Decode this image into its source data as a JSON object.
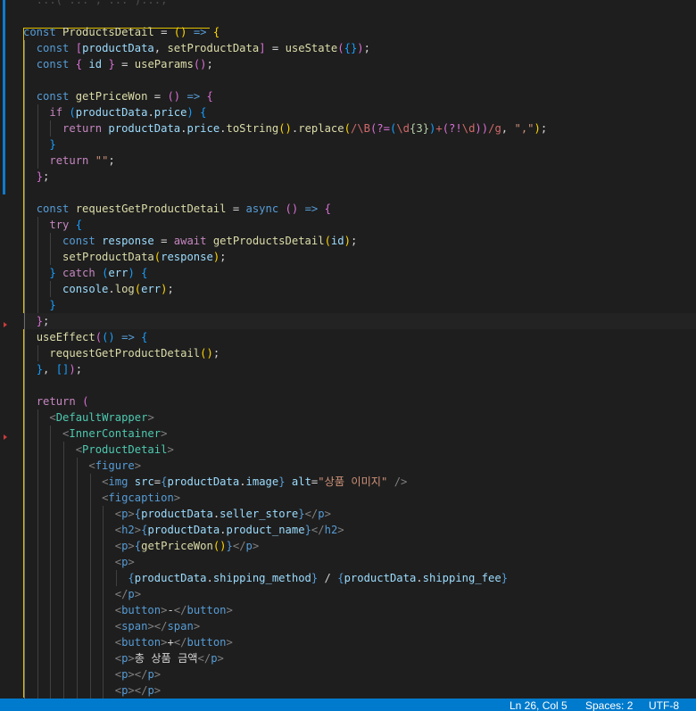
{
  "status_bar": {
    "cursor_position": "Ln 26, Col 5",
    "indentation": "Spaces: 2",
    "encoding": "UTF-8"
  },
  "colors": {
    "background": "#1e1e1e",
    "status_bar": "#007acc"
  },
  "code_lines": [
    {
      "indent": 0,
      "tokens": [
        [
          "p",
          "  ...( ... , ... )...;"
        ]
      ],
      "faded": true
    },
    {
      "indent": 0,
      "tokens": []
    },
    {
      "indent": 0,
      "tokens": [
        [
          "k",
          "const "
        ],
        [
          "f",
          "ProductsDetail"
        ],
        [
          "p",
          " = "
        ],
        [
          "y",
          "()"
        ],
        [
          "p",
          " "
        ],
        [
          "k",
          "=>"
        ],
        [
          "p",
          " "
        ],
        [
          "y",
          "{"
        ]
      ]
    },
    {
      "indent": 1,
      "tokens": [
        [
          "k",
          "const "
        ],
        [
          "pk",
          "["
        ],
        [
          "v",
          "productData"
        ],
        [
          "p",
          ", "
        ],
        [
          "f",
          "setProductData"
        ],
        [
          "pk",
          "]"
        ],
        [
          "p",
          " = "
        ],
        [
          "f",
          "useState"
        ],
        [
          "pk",
          "("
        ],
        [
          "bl",
          "{}"
        ],
        [
          "pk",
          ")"
        ],
        [
          "p",
          ";"
        ]
      ]
    },
    {
      "indent": 1,
      "tokens": [
        [
          "k",
          "const "
        ],
        [
          "pk",
          "{"
        ],
        [
          "p",
          " "
        ],
        [
          "v",
          "id"
        ],
        [
          "p",
          " "
        ],
        [
          "pk",
          "}"
        ],
        [
          "p",
          " = "
        ],
        [
          "f",
          "useParams"
        ],
        [
          "pk",
          "()"
        ],
        [
          "p",
          ";"
        ]
      ]
    },
    {
      "indent": 1,
      "tokens": []
    },
    {
      "indent": 1,
      "tokens": [
        [
          "k",
          "const "
        ],
        [
          "f",
          "getPriceWon"
        ],
        [
          "p",
          " = "
        ],
        [
          "pk",
          "()"
        ],
        [
          "p",
          " "
        ],
        [
          "k",
          "=>"
        ],
        [
          "p",
          " "
        ],
        [
          "pk",
          "{"
        ]
      ]
    },
    {
      "indent": 2,
      "tokens": [
        [
          "ck",
          "if "
        ],
        [
          "bl",
          "("
        ],
        [
          "v",
          "productData"
        ],
        [
          "p",
          "."
        ],
        [
          "v",
          "price"
        ],
        [
          "bl",
          ")"
        ],
        [
          "p",
          " "
        ],
        [
          "bl",
          "{"
        ]
      ]
    },
    {
      "indent": 3,
      "tokens": [
        [
          "ck",
          "return "
        ],
        [
          "v",
          "productData"
        ],
        [
          "p",
          "."
        ],
        [
          "v",
          "price"
        ],
        [
          "p",
          "."
        ],
        [
          "f",
          "toString"
        ],
        [
          "y",
          "()"
        ],
        [
          "p",
          "."
        ],
        [
          "f",
          "replace"
        ],
        [
          "y",
          "("
        ],
        [
          "r",
          "/\\B"
        ],
        [
          "pk",
          "(?="
        ],
        [
          "bl",
          "("
        ],
        [
          "r",
          "\\d"
        ],
        [
          "n",
          "{3}"
        ],
        [
          "bl",
          ")"
        ],
        [
          "r",
          "+"
        ],
        [
          "pk",
          "(?!"
        ],
        [
          "r",
          "\\d"
        ],
        [
          "pk",
          "))"
        ],
        [
          "r",
          "/g"
        ],
        [
          "p",
          ", "
        ],
        [
          "s",
          "\",\""
        ],
        [
          "y",
          ")"
        ],
        [
          "p",
          ";"
        ]
      ]
    },
    {
      "indent": 2,
      "tokens": [
        [
          "bl",
          "}"
        ]
      ]
    },
    {
      "indent": 2,
      "tokens": [
        [
          "ck",
          "return "
        ],
        [
          "s",
          "\"\""
        ],
        [
          "p",
          ";"
        ]
      ]
    },
    {
      "indent": 1,
      "tokens": [
        [
          "pk",
          "}"
        ],
        [
          "p",
          ";"
        ]
      ]
    },
    {
      "indent": 1,
      "tokens": []
    },
    {
      "indent": 1,
      "tokens": [
        [
          "k",
          "const "
        ],
        [
          "f",
          "requestGetProductDetail"
        ],
        [
          "p",
          " = "
        ],
        [
          "k",
          "async "
        ],
        [
          "pk",
          "()"
        ],
        [
          "p",
          " "
        ],
        [
          "k",
          "=>"
        ],
        [
          "p",
          " "
        ],
        [
          "pk",
          "{"
        ]
      ]
    },
    {
      "indent": 2,
      "tokens": [
        [
          "ck",
          "try "
        ],
        [
          "bl",
          "{"
        ]
      ]
    },
    {
      "indent": 3,
      "tokens": [
        [
          "k",
          "const "
        ],
        [
          "v",
          "response"
        ],
        [
          "p",
          " = "
        ],
        [
          "ck",
          "await "
        ],
        [
          "f",
          "getProductsDetail"
        ],
        [
          "y",
          "("
        ],
        [
          "v",
          "id"
        ],
        [
          "y",
          ")"
        ],
        [
          "p",
          ";"
        ]
      ]
    },
    {
      "indent": 3,
      "tokens": [
        [
          "f",
          "setProductData"
        ],
        [
          "y",
          "("
        ],
        [
          "v",
          "response"
        ],
        [
          "y",
          ")"
        ],
        [
          "p",
          ";"
        ]
      ]
    },
    {
      "indent": 2,
      "tokens": [
        [
          "bl",
          "}"
        ],
        [
          "p",
          " "
        ],
        [
          "ck",
          "catch "
        ],
        [
          "bl",
          "("
        ],
        [
          "v",
          "err"
        ],
        [
          "bl",
          ")"
        ],
        [
          "p",
          " "
        ],
        [
          "bl",
          "{"
        ]
      ]
    },
    {
      "indent": 3,
      "tokens": [
        [
          "v",
          "console"
        ],
        [
          "p",
          "."
        ],
        [
          "f",
          "log"
        ],
        [
          "y",
          "("
        ],
        [
          "v",
          "err"
        ],
        [
          "y",
          ")"
        ],
        [
          "p",
          ";"
        ]
      ]
    },
    {
      "indent": 2,
      "tokens": [
        [
          "bl",
          "}"
        ]
      ]
    },
    {
      "indent": 1,
      "tokens": [
        [
          "pk",
          "}"
        ],
        [
          "p",
          ";"
        ]
      ],
      "highlight": true
    },
    {
      "indent": 1,
      "tokens": [
        [
          "f",
          "useEffect"
        ],
        [
          "pk",
          "("
        ],
        [
          "bl",
          "()"
        ],
        [
          "p",
          " "
        ],
        [
          "k",
          "=>"
        ],
        [
          "p",
          " "
        ],
        [
          "bl",
          "{"
        ]
      ]
    },
    {
      "indent": 2,
      "tokens": [
        [
          "f",
          "requestGetProductDetail"
        ],
        [
          "y",
          "()"
        ],
        [
          "p",
          ";"
        ]
      ]
    },
    {
      "indent": 1,
      "tokens": [
        [
          "bl",
          "}"
        ],
        [
          "p",
          ", "
        ],
        [
          "bl",
          "[]"
        ],
        [
          "pk",
          ")"
        ],
        [
          "p",
          ";"
        ]
      ]
    },
    {
      "indent": 1,
      "tokens": []
    },
    {
      "indent": 1,
      "tokens": [
        [
          "ck",
          "return "
        ],
        [
          "pk",
          "("
        ]
      ]
    },
    {
      "indent": 2,
      "tokens": [
        [
          "tg",
          "<"
        ],
        [
          "t",
          "DefaultWrapper"
        ],
        [
          "tg",
          ">"
        ]
      ]
    },
    {
      "indent": 3,
      "tokens": [
        [
          "tg",
          "<"
        ],
        [
          "t",
          "InnerContainer"
        ],
        [
          "tg",
          ">"
        ]
      ]
    },
    {
      "indent": 4,
      "tokens": [
        [
          "tg",
          "<"
        ],
        [
          "t",
          "ProductDetail"
        ],
        [
          "tg",
          ">"
        ]
      ]
    },
    {
      "indent": 5,
      "tokens": [
        [
          "tg",
          "<"
        ],
        [
          "k",
          "figure"
        ],
        [
          "tg",
          ">"
        ]
      ]
    },
    {
      "indent": 6,
      "tokens": [
        [
          "tg",
          "<"
        ],
        [
          "k",
          "img "
        ],
        [
          "a",
          "src"
        ],
        [
          "p",
          "="
        ],
        [
          "k",
          "{"
        ],
        [
          "v",
          "productData"
        ],
        [
          "p",
          "."
        ],
        [
          "v",
          "image"
        ],
        [
          "k",
          "}"
        ],
        [
          "p",
          " "
        ],
        [
          "a",
          "alt"
        ],
        [
          "p",
          "="
        ],
        [
          "s",
          "\"상품 이미지\""
        ],
        [
          "p",
          " "
        ],
        [
          "tg",
          "/>"
        ]
      ]
    },
    {
      "indent": 6,
      "tokens": [
        [
          "tg",
          "<"
        ],
        [
          "k",
          "figcaption"
        ],
        [
          "tg",
          ">"
        ]
      ]
    },
    {
      "indent": 7,
      "tokens": [
        [
          "tg",
          "<"
        ],
        [
          "k",
          "p"
        ],
        [
          "tg",
          ">"
        ],
        [
          "k",
          "{"
        ],
        [
          "v",
          "productData"
        ],
        [
          "p",
          "."
        ],
        [
          "v",
          "seller_store"
        ],
        [
          "k",
          "}"
        ],
        [
          "tg",
          "</"
        ],
        [
          "k",
          "p"
        ],
        [
          "tg",
          ">"
        ]
      ]
    },
    {
      "indent": 7,
      "tokens": [
        [
          "tg",
          "<"
        ],
        [
          "k",
          "h2"
        ],
        [
          "tg",
          ">"
        ],
        [
          "k",
          "{"
        ],
        [
          "v",
          "productData"
        ],
        [
          "p",
          "."
        ],
        [
          "v",
          "product_name"
        ],
        [
          "k",
          "}"
        ],
        [
          "tg",
          "</"
        ],
        [
          "k",
          "h2"
        ],
        [
          "tg",
          ">"
        ]
      ]
    },
    {
      "indent": 7,
      "tokens": [
        [
          "tg",
          "<"
        ],
        [
          "k",
          "p"
        ],
        [
          "tg",
          ">"
        ],
        [
          "k",
          "{"
        ],
        [
          "f",
          "getPriceWon"
        ],
        [
          "y",
          "()"
        ],
        [
          "k",
          "}"
        ],
        [
          "tg",
          "</"
        ],
        [
          "k",
          "p"
        ],
        [
          "tg",
          ">"
        ]
      ]
    },
    {
      "indent": 7,
      "tokens": [
        [
          "tg",
          "<"
        ],
        [
          "k",
          "p"
        ],
        [
          "tg",
          ">"
        ]
      ]
    },
    {
      "indent": 8,
      "tokens": [
        [
          "k",
          "{"
        ],
        [
          "v",
          "productData"
        ],
        [
          "p",
          "."
        ],
        [
          "v",
          "shipping_method"
        ],
        [
          "k",
          "}"
        ],
        [
          "p",
          " / "
        ],
        [
          "k",
          "{"
        ],
        [
          "v",
          "productData"
        ],
        [
          "p",
          "."
        ],
        [
          "v",
          "shipping_fee"
        ],
        [
          "k",
          "}"
        ]
      ]
    },
    {
      "indent": 7,
      "tokens": [
        [
          "tg",
          "</"
        ],
        [
          "k",
          "p"
        ],
        [
          "tg",
          ">"
        ]
      ]
    },
    {
      "indent": 7,
      "tokens": [
        [
          "tg",
          "<"
        ],
        [
          "k",
          "button"
        ],
        [
          "tg",
          ">"
        ],
        [
          "p",
          "-"
        ],
        [
          "tg",
          "</"
        ],
        [
          "k",
          "button"
        ],
        [
          "tg",
          ">"
        ]
      ]
    },
    {
      "indent": 7,
      "tokens": [
        [
          "tg",
          "<"
        ],
        [
          "k",
          "span"
        ],
        [
          "tg",
          "></"
        ],
        [
          "k",
          "span"
        ],
        [
          "tg",
          ">"
        ]
      ]
    },
    {
      "indent": 7,
      "tokens": [
        [
          "tg",
          "<"
        ],
        [
          "k",
          "button"
        ],
        [
          "tg",
          ">"
        ],
        [
          "p",
          "+"
        ],
        [
          "tg",
          "</"
        ],
        [
          "k",
          "button"
        ],
        [
          "tg",
          ">"
        ]
      ]
    },
    {
      "indent": 7,
      "tokens": [
        [
          "tg",
          "<"
        ],
        [
          "k",
          "p"
        ],
        [
          "tg",
          ">"
        ],
        [
          "p",
          "총 상품 금액"
        ],
        [
          "tg",
          "</"
        ],
        [
          "k",
          "p"
        ],
        [
          "tg",
          ">"
        ]
      ]
    },
    {
      "indent": 7,
      "tokens": [
        [
          "tg",
          "<"
        ],
        [
          "k",
          "p"
        ],
        [
          "tg",
          "></"
        ],
        [
          "k",
          "p"
        ],
        [
          "tg",
          ">"
        ]
      ]
    },
    {
      "indent": 7,
      "tokens": [
        [
          "tg",
          "<"
        ],
        [
          "k",
          "p"
        ],
        [
          "tg",
          "></"
        ],
        [
          "k",
          "p"
        ],
        [
          "tg",
          ">"
        ]
      ]
    }
  ]
}
